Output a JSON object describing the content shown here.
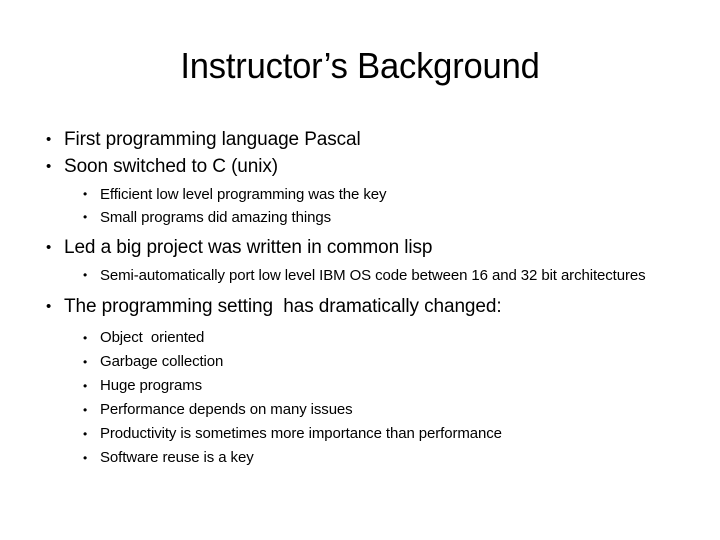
{
  "slide": {
    "title": "Instructor’s Background",
    "background_color": "#ffffff",
    "text_color": "#000000",
    "bullet_glyph": "•",
    "content": [
      {
        "level": 1,
        "text": "First programming language Pascal"
      },
      {
        "level": 1,
        "text": "Soon switched to C (unix)"
      },
      {
        "level": 2,
        "text": "Efficient low level programming was the key"
      },
      {
        "level": 2,
        "text": "Small programs did amazing things"
      },
      {
        "level": 1,
        "text": "Led a big project was written in common lisp"
      },
      {
        "level": 2,
        "text": "Semi-automatically port low level IBM OS code between 16 and 32 bit architectures"
      },
      {
        "level": 1,
        "text": "The programming setting  has dramatically changed:"
      },
      {
        "level": 3,
        "text": "Object  oriented"
      },
      {
        "level": 3,
        "text": "Garbage collection"
      },
      {
        "level": 3,
        "text": "Huge programs"
      },
      {
        "level": 3,
        "text": "Performance depends on many issues"
      },
      {
        "level": 3,
        "text": "Productivity is sometimes more importance than performance"
      },
      {
        "level": 3,
        "text": "Software reuse is a key"
      }
    ]
  }
}
